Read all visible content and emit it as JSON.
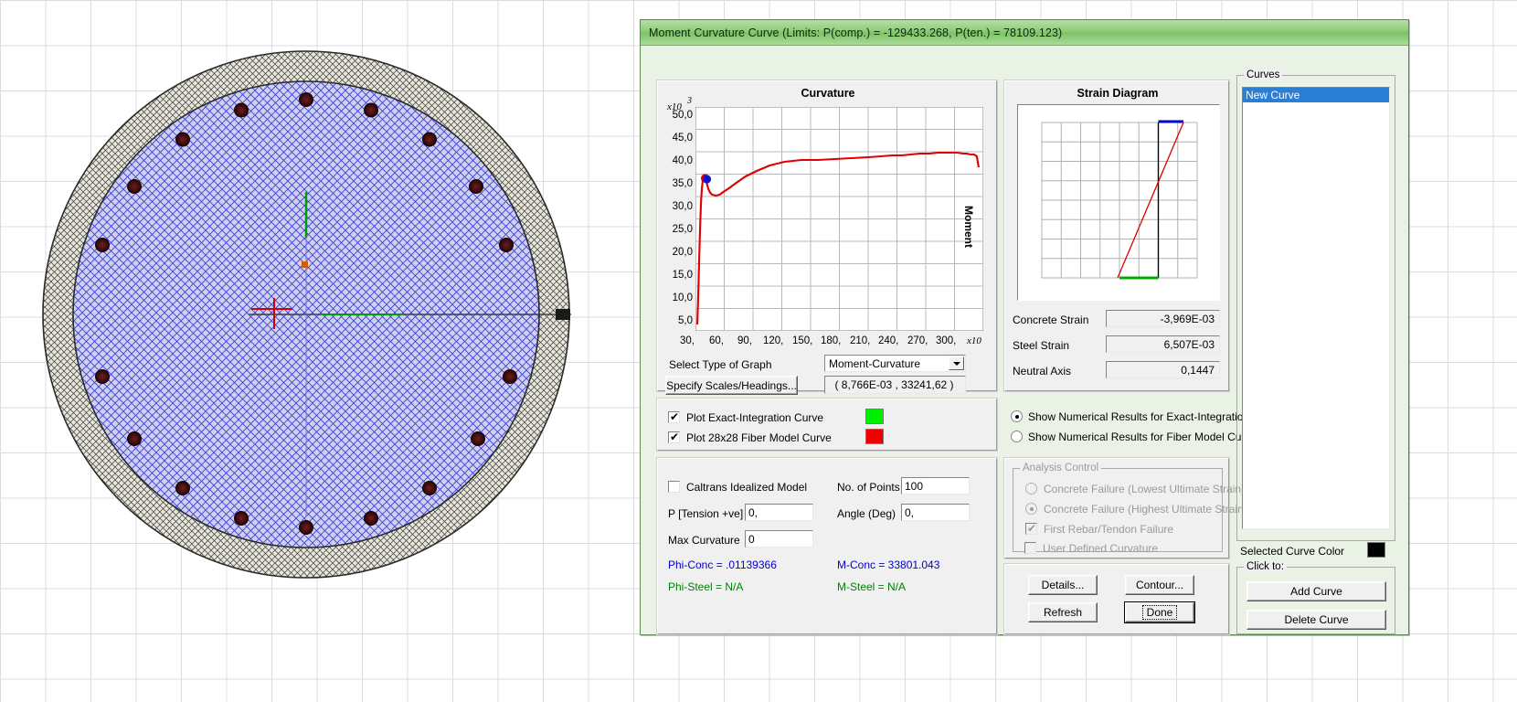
{
  "window": {
    "title": "Moment Curvature Curve (Limits:  P(comp.) = -129433.268, P(ten.) = 78109.123)"
  },
  "curvature_panel": {
    "title": "Curvature",
    "y_multiplier": "x10",
    "y_exponent": "3",
    "x_multiplier": "x10",
    "vertical_label": "Moment"
  },
  "strain_panel": {
    "title": "Strain Diagram",
    "concrete_strain_label": "Concrete Strain",
    "concrete_strain_value": "-3,969E-03",
    "steel_strain_label": "Steel Strain",
    "steel_strain_value": "6,507E-03",
    "neutral_axis_label": "Neutral Axis",
    "neutral_axis_value": "0,1447"
  },
  "graph_controls": {
    "select_type_label": "Select Type of Graph",
    "select_type_value": "Moment-Curvature",
    "specify_scales_button": "Specify Scales/Headings...",
    "coordinate_readout": "( 8,766E-03 , 33241,62 )"
  },
  "plot_options": {
    "exact_integration_label": "Plot Exact-Integration Curve",
    "exact_integration_checked": true,
    "exact_integration_color": "#00ee00",
    "fiber_model_label": "Plot 28x28 Fiber Model Curve",
    "fiber_model_checked": true,
    "fiber_model_color": "#ee0000",
    "radio_exact_label": "Show Numerical Results for Exact-Integration Curve",
    "radio_fiber_label": "Show Numerical Results for Fiber Model Curve",
    "radio_selected": "exact"
  },
  "inputs": {
    "caltrans_label": "Caltrans Idealized Model",
    "caltrans_checked": false,
    "p_tension_label": "P [Tension +ve]",
    "p_tension_value": "0,",
    "max_curvature_label": "Max Curvature",
    "max_curvature_value": "0",
    "no_points_label": "No. of Points",
    "no_points_value": "100",
    "angle_label": "Angle (Deg)",
    "angle_value": "0,",
    "phi_conc": "Phi-Conc = .01139366",
    "m_conc": "M-Conc = 33801.043",
    "phi_steel": "Phi-Steel = N/A",
    "m_steel": "M-Steel = N/A"
  },
  "analysis_control": {
    "group_title": "Analysis Control",
    "opt_lowest": "Concrete Failure (Lowest Ultimate Strain)",
    "opt_highest": "Concrete Failure (Highest Ultimate Strain)",
    "opt_rebar": "First Rebar/Tendon Failure",
    "opt_user": "User Defined Curvature",
    "selected": "highest",
    "rebar_checked": true,
    "user_checked": false
  },
  "action_buttons": {
    "details": "Details...",
    "contour": "Contour...",
    "refresh": "Refresh",
    "done": "Done"
  },
  "curves_panel": {
    "group_title": "Curves",
    "items": [
      "New Curve"
    ],
    "selected_index": 0,
    "selected_color_label": "Selected Curve Color",
    "selected_color": "#000000",
    "click_to_label": "Click to:",
    "add_curve": "Add Curve",
    "delete_curve": "Delete Curve"
  },
  "chart_data": {
    "type": "line",
    "title": "Curvature",
    "xlabel": "Curvature",
    "ylabel": "Moment",
    "xlim": [
      0,
      310
    ],
    "ylim": [
      0,
      52
    ],
    "x_ticks": [
      30,
      60,
      90,
      120,
      150,
      180,
      210,
      240,
      270,
      300
    ],
    "y_ticks": [
      5.0,
      10.0,
      15.0,
      20.0,
      25.0,
      30.0,
      35.0,
      40.0,
      45.0,
      50.0
    ],
    "y_tick_labels": [
      "5,0",
      "10,0",
      "15,0",
      "20,0",
      "25,0",
      "30,0",
      "35,0",
      "40,0",
      "45,0",
      "50,0"
    ],
    "x_tick_labels": [
      "30,",
      "60,",
      "90,",
      "120,",
      "150,",
      "180,",
      "210,",
      "240,",
      "270,",
      "300,"
    ],
    "x_multiplier": "x10",
    "y_multiplier": "x10",
    "y_exponent": "3",
    "grid": true,
    "legend": "none",
    "series": [
      {
        "name": "Fiber Model Curve",
        "color": "#e00000",
        "x": [
          2,
          3,
          4,
          5,
          6,
          7,
          8,
          10,
          12,
          14,
          16,
          18,
          22,
          26,
          30,
          36,
          44,
          54,
          66,
          80,
          96,
          114,
          132,
          150,
          168,
          186,
          200,
          212,
          222,
          232,
          242,
          252,
          262,
          272,
          282,
          288,
          292,
          296,
          300,
          303,
          304
        ],
        "y": [
          1.5,
          8.0,
          16.5,
          24.0,
          30.0,
          33.5,
          35.2,
          35.6,
          34.6,
          33.2,
          32.3,
          31.8,
          31.6,
          31.9,
          32.4,
          33.3,
          34.6,
          36.0,
          37.3,
          38.4,
          39.3,
          39.8,
          39.7,
          39.9,
          40.1,
          40.3,
          40.5,
          40.7,
          40.8,
          41.0,
          41.1,
          41.2,
          41.3,
          41.4,
          41.3,
          41.2,
          41.1,
          41.0,
          40.9,
          40.6,
          38.0
        ]
      }
    ],
    "markers": [
      {
        "name": "yield-point",
        "x": 10,
        "y": 35.4,
        "color": "#1010d0"
      }
    ]
  },
  "strain_chart": {
    "type": "line",
    "compression_edge_color": "#0000cc",
    "tension_edge_color": "#00aa00",
    "strain_line_color": "#dd0000",
    "section_outline_color": "#000000"
  }
}
